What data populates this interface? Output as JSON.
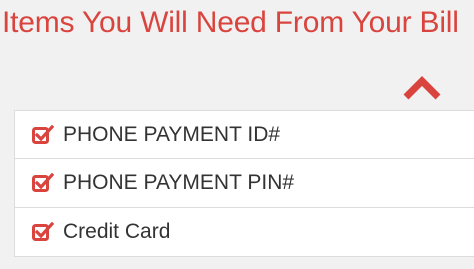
{
  "panel": {
    "title": "Items You Will Need From Your Bill",
    "toggle_icon": "chevron-up-icon",
    "accent_color": "#d9453e"
  },
  "items": [
    {
      "label": "PHONE PAYMENT ID#",
      "icon": "checked-box-icon",
      "checked": true
    },
    {
      "label": "PHONE PAYMENT PIN#",
      "icon": "checked-box-icon",
      "checked": true
    },
    {
      "label": "Credit Card",
      "icon": "checked-box-icon",
      "checked": true
    }
  ]
}
